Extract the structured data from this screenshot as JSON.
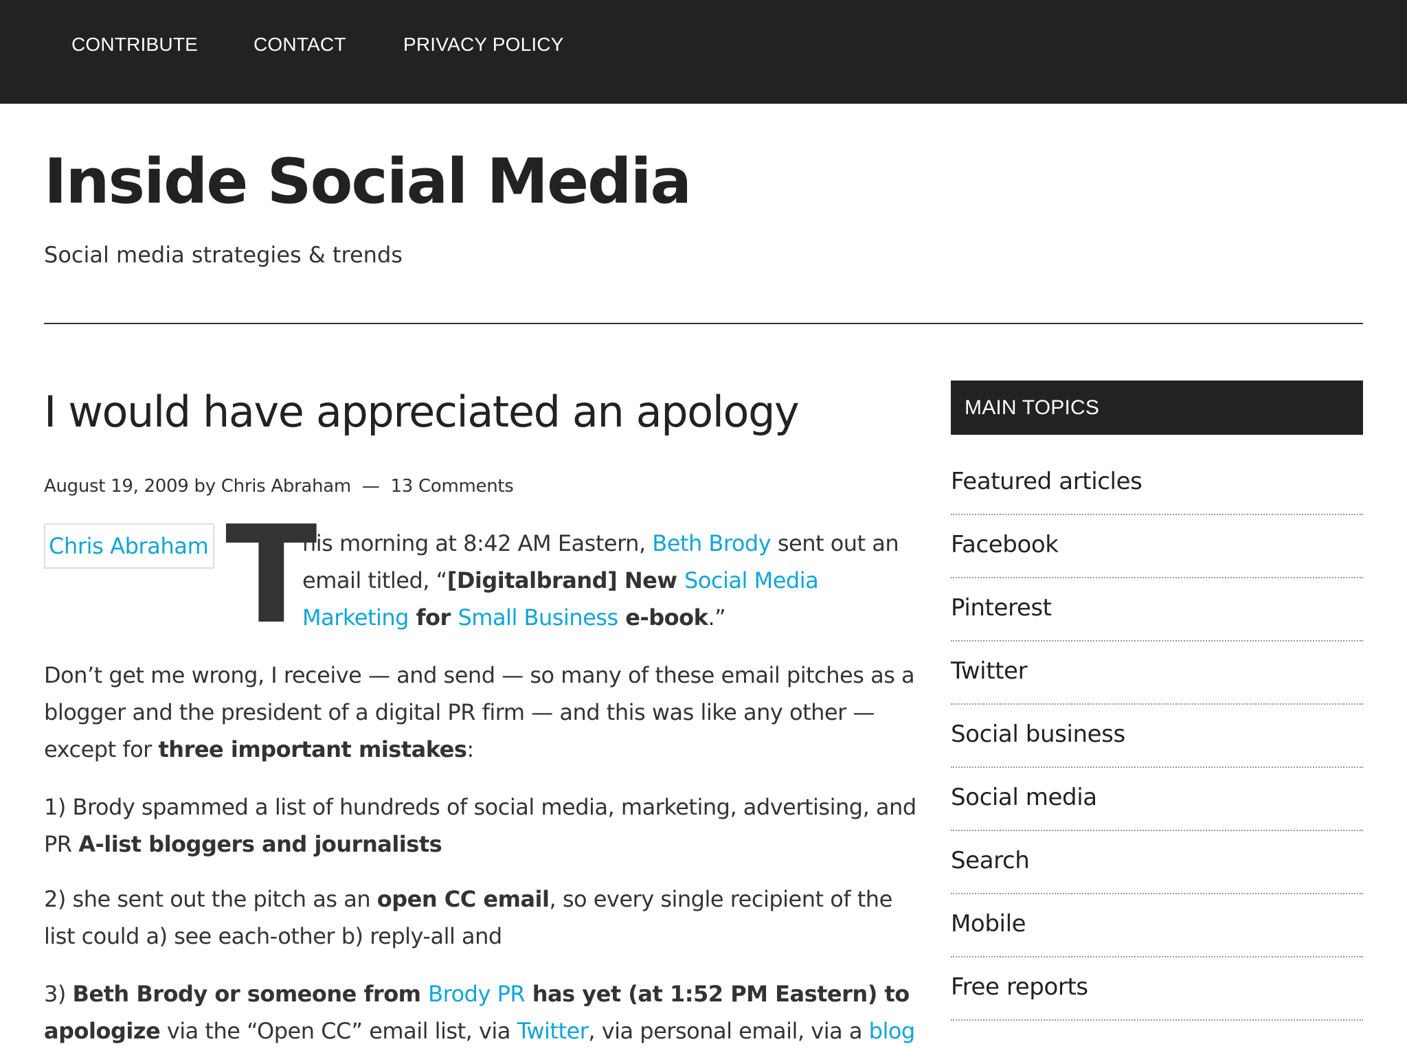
{
  "nav": {
    "items": [
      "CONTRIBUTE",
      "CONTACT",
      "PRIVACY POLICY"
    ]
  },
  "site": {
    "title": "Inside Social Media",
    "description": "Social media strategies & trends"
  },
  "post": {
    "title": "I would have appreciated an apology",
    "date": "August 19, 2009",
    "by": "by",
    "author": "Chris Abraham",
    "separator": "—",
    "comments": "13 Comments",
    "author_image_alt": "Chris Abraham",
    "dropcap": "T",
    "p1": {
      "t1": "his morning at 8:42 AM Eastern, ",
      "link1": "Beth Brody",
      "t2": " sent out an email titled, “",
      "b1": "[Digitalbrand] New ",
      "link2": "Social Media Marketing",
      "b2": " for ",
      "link3": "Small Business",
      "b3": " e-book",
      "t3": ".”"
    },
    "p2": {
      "t1": "Don’t get me wrong, I receive — and send — so many of these email pitches as a blogger and the president of a digital PR firm — and this was like any other — except for ",
      "b1": "three important mistakes",
      "t2": ":"
    },
    "p3": {
      "t1": "1) Brody spammed a list of hundreds of social media, marketing, advertising, and PR ",
      "b1": "A-list bloggers and journalists"
    },
    "p4": {
      "t1": "2) she sent out the pitch as an ",
      "b1": "open CC email",
      "t2": ", so every single recipient of the list could a) see each-other b) reply-all and"
    },
    "p5": {
      "t1": "3) ",
      "b1": "Beth Brody or someone from ",
      "link1": "Brody PR",
      "b2": " has yet (at 1:52 PM Eastern) to apologize",
      "t2": " via the “Open CC” email list, via ",
      "link2": "Twitter",
      "t3": ", via personal email, via a ",
      "link3": "blog"
    }
  },
  "sidebar": {
    "heading": "MAIN TOPICS",
    "topics": [
      "Featured articles",
      "Facebook",
      "Pinterest",
      "Twitter",
      "Social business",
      "Social media",
      "Search",
      "Mobile",
      "Free reports"
    ]
  },
  "colors": {
    "topbar": "#222222",
    "link": "#0ea5d8",
    "text": "#333333"
  }
}
